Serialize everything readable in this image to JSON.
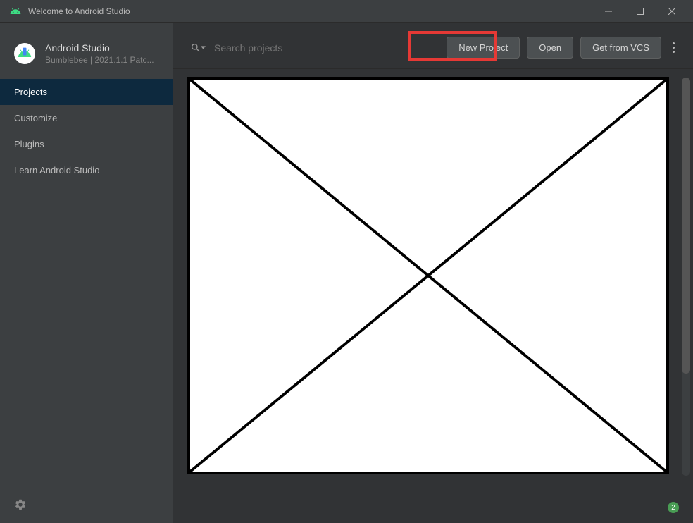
{
  "window": {
    "title": "Welcome to Android Studio"
  },
  "sidebar": {
    "appName": "Android Studio",
    "appVersion": "Bumblebee | 2021.1.1 Patc...",
    "items": [
      {
        "label": "Projects",
        "active": true
      },
      {
        "label": "Customize",
        "active": false
      },
      {
        "label": "Plugins",
        "active": false
      },
      {
        "label": "Learn Android Studio",
        "active": false
      }
    ]
  },
  "toolbar": {
    "searchPlaceholder": "Search projects",
    "newProject": "New Project",
    "open": "Open",
    "getFromVCS": "Get from VCS"
  },
  "statusBadge": "2"
}
